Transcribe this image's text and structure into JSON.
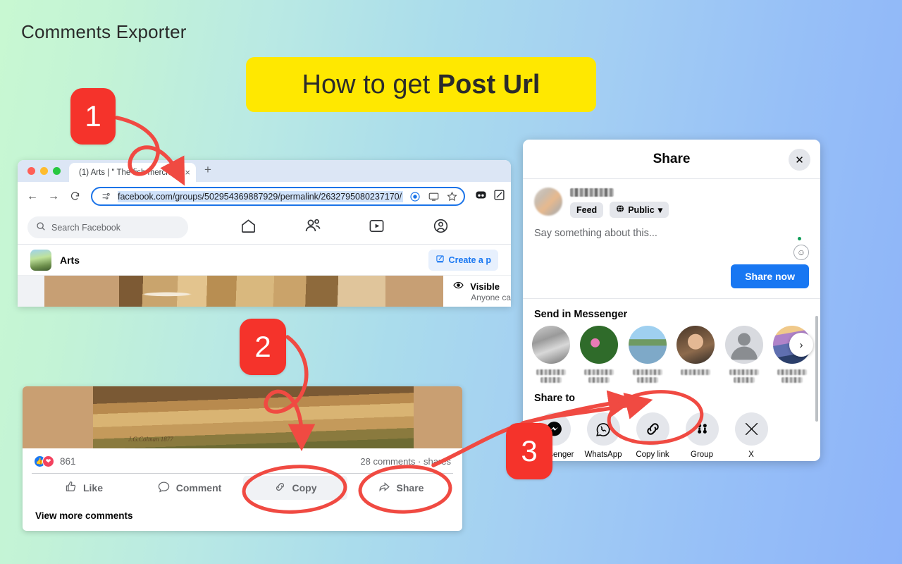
{
  "app": {
    "title": "Comments Exporter"
  },
  "banner": {
    "prefix": "How to get ",
    "highlight": "Post Url"
  },
  "steps": [
    {
      "n": "1"
    },
    {
      "n": "2"
    },
    {
      "n": "3"
    }
  ],
  "browser": {
    "tab": {
      "title": "(1) Arts | \" The fish mercha",
      "close": "×"
    },
    "newtab": "+",
    "nav": {
      "back": "←",
      "forward": "→",
      "reload": "↻"
    },
    "omnibox": {
      "url": "facebook.com/groups/502954369887929/permalink/2632795080237170/",
      "site_icon": "site-settings-icon",
      "lens_icon": "lens-icon",
      "install_icon": "install-icon",
      "star_icon": "bookmark-star-icon"
    }
  },
  "facebook": {
    "search_placeholder": "Search Facebook",
    "nav_icons": [
      "home-icon",
      "friends-icon",
      "video-icon",
      "profile-icon"
    ],
    "group": {
      "name": "Arts",
      "create_button": "Create a p"
    },
    "visibility": {
      "title": "Visible",
      "subtitle": "Anyone ca"
    }
  },
  "post": {
    "signature": "J.G.Colman 1877",
    "reaction_count": "861",
    "stats_right": "28 comments  ·  shares",
    "actions": [
      {
        "label": "Like",
        "icon": "thumbs-up-icon",
        "highlighted": false
      },
      {
        "label": "Comment",
        "icon": "comment-bubble-icon",
        "highlighted": false
      },
      {
        "label": "Copy",
        "icon": "link-icon",
        "highlighted": true
      },
      {
        "label": "Share",
        "icon": "share-arrow-icon",
        "highlighted": false
      }
    ],
    "view_more": "View more comments"
  },
  "share_dialog": {
    "title": "Share",
    "close": "✕",
    "composer": {
      "feed_chip": "Feed",
      "audience_chip": "Public",
      "placeholder": "Say something about this...",
      "share_now": "Share now"
    },
    "messenger_section": "Send in Messenger",
    "messenger_next": "›",
    "share_to_section": "Share to",
    "share_targets": [
      {
        "label": "Messenger",
        "icon": "messenger-icon"
      },
      {
        "label": "WhatsApp",
        "icon": "whatsapp-icon"
      },
      {
        "label": "Copy link",
        "icon": "link-chain-icon"
      },
      {
        "label": "Group",
        "icon": "group-icon"
      },
      {
        "label": "X",
        "icon": "x-twitter-icon"
      }
    ]
  },
  "colors": {
    "accent_red": "#f5332b",
    "banner_yellow": "#ffe800",
    "facebook_blue": "#1877f2",
    "bg_start": "#c8f8d2",
    "bg_end": "#8db3f9"
  }
}
